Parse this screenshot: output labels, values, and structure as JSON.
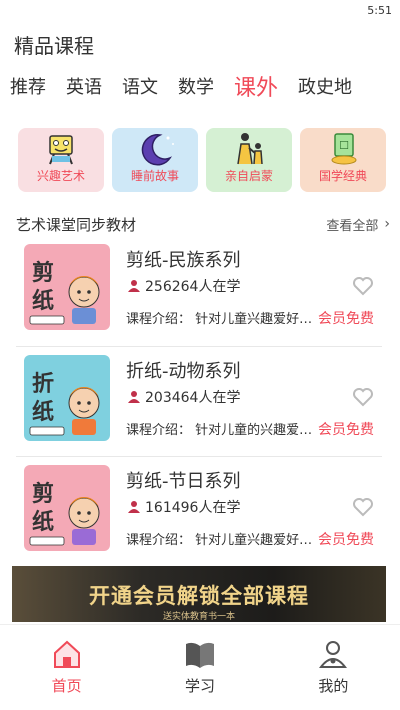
{
  "status": {
    "time": "5:51"
  },
  "header": {
    "title": "精品课程"
  },
  "tabs": [
    {
      "label": "推荐"
    },
    {
      "label": "英语"
    },
    {
      "label": "语文"
    },
    {
      "label": "数学"
    },
    {
      "label": "课外",
      "active": true
    },
    {
      "label": "政史地"
    }
  ],
  "categories": [
    {
      "label": "兴趣艺术",
      "icon": "easel-icon"
    },
    {
      "label": "睡前故事",
      "icon": "moon-icon"
    },
    {
      "label": "亲自启蒙",
      "icon": "parent-child-icon"
    },
    {
      "label": "国学经典",
      "icon": "book-icon"
    }
  ],
  "section": {
    "title": "艺术课堂同步教材",
    "view_all": "查看全部"
  },
  "courses": [
    {
      "title": "剪纸-民族系列",
      "learners": "256264人在学",
      "desc": "课程介绍：   针对儿童兴趣爱好设计",
      "badge": "会员免费",
      "thumb_text": "剪纸",
      "thumb_bg": "#f4a9b6"
    },
    {
      "title": "折纸-动物系列",
      "learners": "203464人在学",
      "desc": "课程介绍：   针对儿童的兴趣爱好设计",
      "badge": "会员免费",
      "thumb_text": "折纸",
      "thumb_bg": "#7fd0df"
    },
    {
      "title": "剪纸-节日系列",
      "learners": "161496人在学",
      "desc": "课程介绍：   针对儿童兴趣爱好设计",
      "badge": "会员免费",
      "thumb_text": "剪纸",
      "thumb_bg": "#f4a9b6"
    }
  ],
  "banner": {
    "main": "开通会员解锁全部课程",
    "sub": "送实体教育书一本"
  },
  "nav": [
    {
      "label": "首页",
      "active": true
    },
    {
      "label": "学习"
    },
    {
      "label": "我的"
    }
  ],
  "colors": {
    "accent": "#f04a58"
  }
}
